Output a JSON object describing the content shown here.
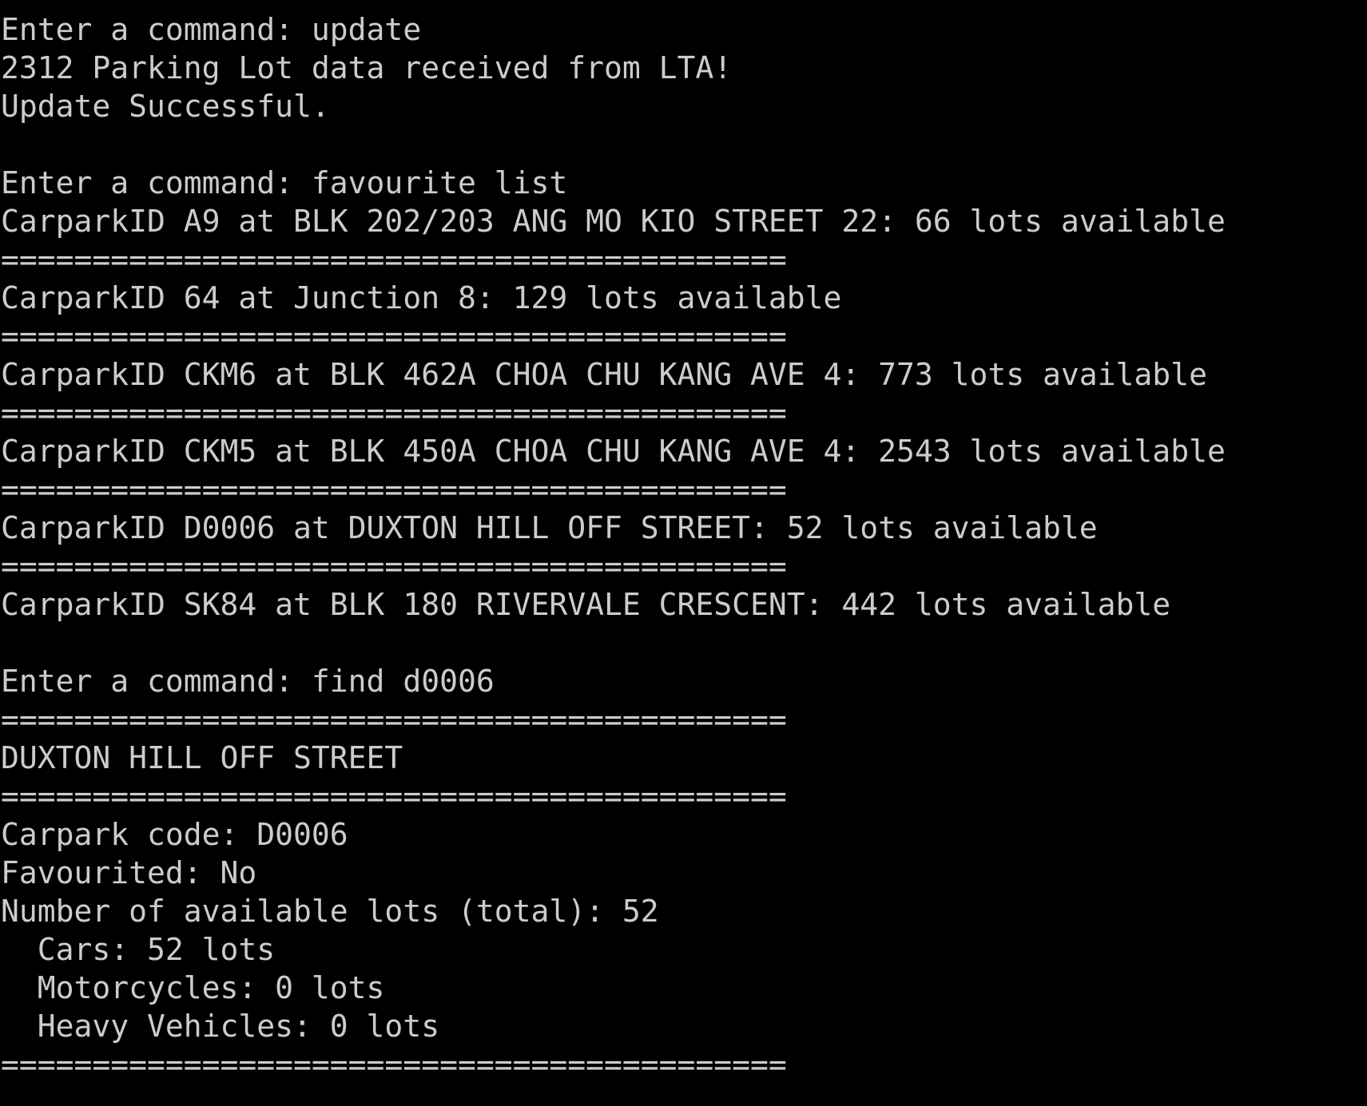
{
  "terminal": {
    "text_color": "#cccccc",
    "background": "#000000",
    "lines": [
      "Enter a command: update",
      "2312 Parking Lot data received from LTA!",
      "Update Successful.",
      "",
      "Enter a command: favourite list",
      "CarparkID A9 at BLK 202/203 ANG MO KIO STREET 22: 66 lots available",
      "===========================================",
      "CarparkID 64 at Junction 8: 129 lots available",
      "===========================================",
      "CarparkID CKM6 at BLK 462A CHOA CHU KANG AVE 4: 773 lots available",
      "===========================================",
      "CarparkID CKM5 at BLK 450A CHOA CHU KANG AVE 4: 2543 lots available",
      "===========================================",
      "CarparkID D0006 at DUXTON HILL OFF STREET: 52 lots available",
      "===========================================",
      "CarparkID SK84 at BLK 180 RIVERVALE CRESCENT: 442 lots available",
      "",
      "Enter a command: find d0006",
      "===========================================",
      "DUXTON HILL OFF STREET",
      "===========================================",
      "Carpark code: D0006",
      "Favourited: No",
      "Number of available lots (total): 52",
      "  Cars: 52 lots",
      "  Motorcycles: 0 lots",
      "  Heavy Vehicles: 0 lots",
      "==========================================="
    ]
  }
}
